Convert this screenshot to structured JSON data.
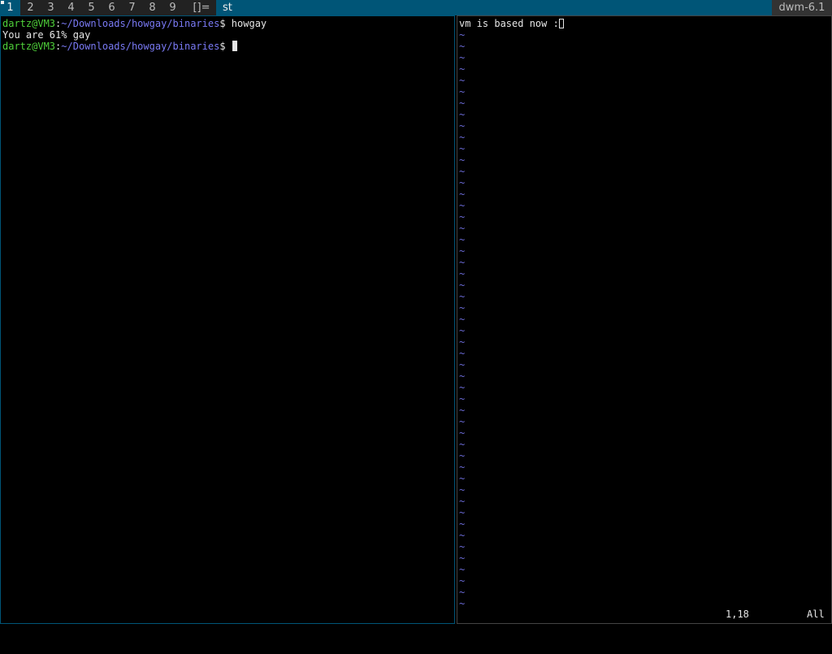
{
  "bar": {
    "tags": [
      "1",
      "2",
      "3",
      "4",
      "5",
      "6",
      "7",
      "8",
      "9"
    ],
    "selected_tag": "1",
    "layout_symbol": "[]=",
    "window_title": "st",
    "status_text": "dwm-6.1",
    "colors": {
      "sel_bg": "#005577",
      "norm_bg": "#222222",
      "norm_fg": "#bbbbbb",
      "sel_fg": "#eeeeee"
    }
  },
  "left_terminal": {
    "line1": {
      "user_host": "dartz@VM3",
      "colon": ":",
      "path": "~/Downloads/howgay/binaries",
      "prompt": "$ ",
      "command": "howgay"
    },
    "line2": {
      "output": "You are 61% gay"
    },
    "line3": {
      "user_host": "dartz@VM3",
      "colon": ":",
      "path": "~/Downloads/howgay/binaries",
      "prompt": "$ "
    },
    "colors": {
      "user_host": "#4fd13a",
      "path": "#7a7af5",
      "text": "#e6e6e6"
    }
  },
  "right_vim": {
    "buffer_text": "vm is based now :",
    "cursor_char": "",
    "empty_line_marker": "~",
    "empty_line_count": 51,
    "ruler": "1,18",
    "scroll_position": "All"
  }
}
